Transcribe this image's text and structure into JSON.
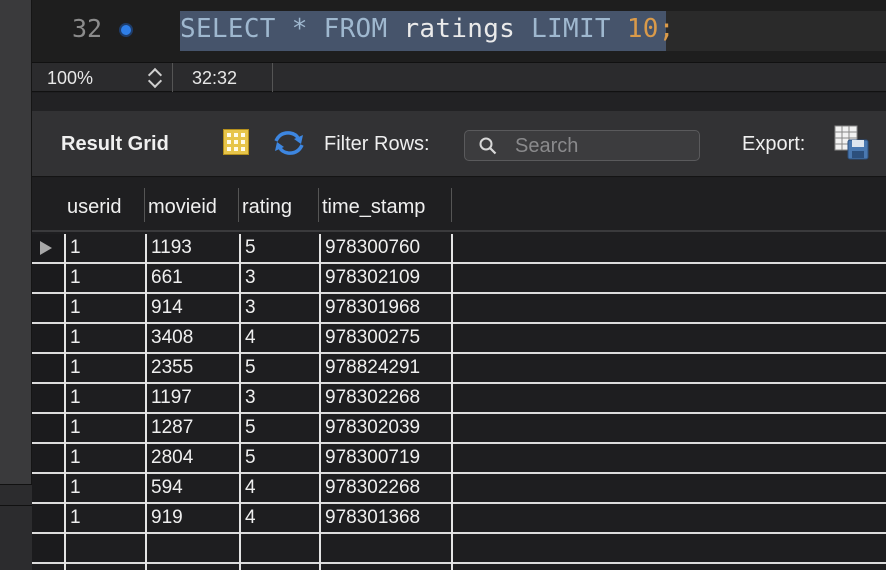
{
  "editor": {
    "line_number": "32",
    "sql": {
      "select": "SELECT",
      "star": "*",
      "from": "FROM",
      "table": "ratings",
      "limit": "LIMIT",
      "count": "10",
      "semicolon": ";"
    }
  },
  "status_bar": {
    "zoom": "100%",
    "cursor_position": "32:32"
  },
  "toolbar": {
    "result_grid_label": "Result Grid",
    "filter_label": "Filter Rows:",
    "search_placeholder": "Search",
    "export_label": "Export:"
  },
  "icons": [
    "breakpoint-dot-icon",
    "zoom-stepper-icon",
    "grid-layout-icon",
    "refresh-icon",
    "search-icon",
    "export-icon",
    "current-row-marker-icon"
  ],
  "colors": {
    "selection": "#46546b",
    "keyword": "#9fb8cf",
    "number": "#d99a4a",
    "breakpoint": "#2f7fe8"
  },
  "table": {
    "columns": [
      "userid",
      "movieid",
      "rating",
      "time_stamp"
    ],
    "rows": [
      [
        "1",
        "1193",
        "5",
        "978300760"
      ],
      [
        "1",
        "661",
        "3",
        "978302109"
      ],
      [
        "1",
        "914",
        "3",
        "978301968"
      ],
      [
        "1",
        "3408",
        "4",
        "978300275"
      ],
      [
        "1",
        "2355",
        "5",
        "978824291"
      ],
      [
        "1",
        "1197",
        "3",
        "978302268"
      ],
      [
        "1",
        "1287",
        "5",
        "978302039"
      ],
      [
        "1",
        "2804",
        "5",
        "978300719"
      ],
      [
        "1",
        "594",
        "4",
        "978302268"
      ],
      [
        "1",
        "919",
        "4",
        "978301368"
      ]
    ]
  }
}
